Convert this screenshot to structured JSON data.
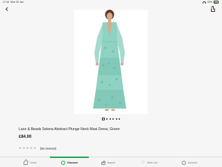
{
  "status_bar": {
    "time": "17:16",
    "date": "Mon 20 Jan",
    "battery": "33%"
  },
  "nav": {
    "back_icon": "chevron-left-icon",
    "share_icon": "share-icon"
  },
  "product": {
    "image_alt": "Woman wearing a green tiered maxi dress",
    "title": "Lace & Beads Selena Abstract Plunge Neck Maxi Dress, Green",
    "price": "£84.00",
    "rating_stars": 0,
    "rating_max": 5,
    "review_text": "(No reviews)",
    "image_count": 6,
    "active_image": 1,
    "colors": {
      "dress": "#8fd1c2",
      "dress_dark": "#5fae9c",
      "background": "#ffffff"
    }
  },
  "tab_bar": {
    "tabs": [
      {
        "label": "Home",
        "icon": "home-icon",
        "active": false
      },
      {
        "label": "Discover",
        "icon": "discover-icon",
        "active": true
      },
      {
        "label": "Basket",
        "icon": "basket-icon",
        "active": false
      },
      {
        "label": "Wish List",
        "icon": "heart-icon",
        "active": false
      },
      {
        "label": "Account",
        "icon": "account-icon",
        "active": false
      }
    ],
    "accent_color": "#1aa14b"
  }
}
